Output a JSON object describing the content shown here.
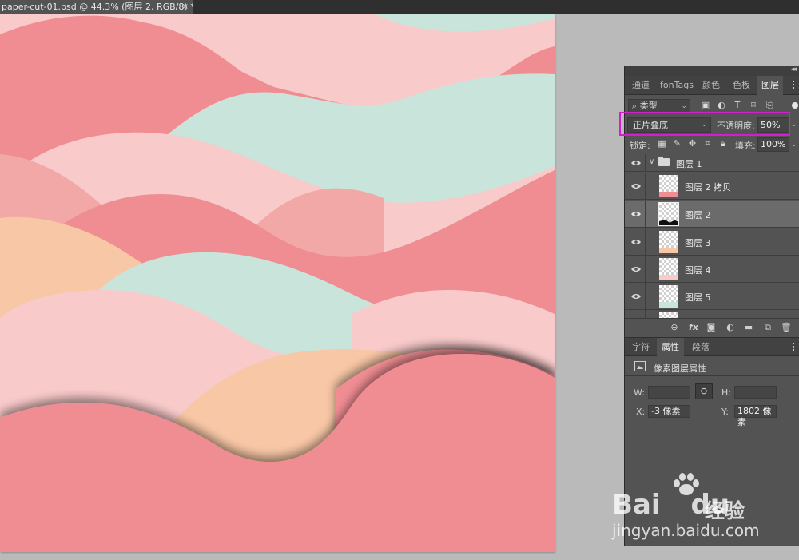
{
  "document": {
    "tab_title": "paper-cut-01.psd @ 44.3% (图层 2, RGB/8) *",
    "close_glyph": "×"
  },
  "colors": {
    "pink_light": "#f9caca",
    "pink_mid": "#f3a8a8",
    "pink_dark": "#f08d93",
    "mint": "#c9e4da",
    "peach": "#f8c7a6",
    "highlight": "#d61cd0"
  },
  "layers_panel": {
    "tabs": [
      "通道",
      "fonTags",
      "颜色",
      "色板",
      "图层"
    ],
    "active_tab": "图层",
    "filter": {
      "label": "类型",
      "icons": [
        "image-filter-icon",
        "adjustment-filter-icon",
        "type-filter-icon",
        "shape-filter-icon",
        "smart-object-filter-icon"
      ]
    },
    "blend_mode": "正片叠底",
    "opacity_label": "不透明度:",
    "opacity_value": "50%",
    "lock_label": "锁定:",
    "fill_label": "填充:",
    "fill_value": "100%",
    "group": {
      "name": "图层 1",
      "visible": true
    },
    "layers": [
      {
        "name": "图层 2 拷贝",
        "visible": true,
        "thumb_color": "#f08d93",
        "selected": false
      },
      {
        "name": "图层 2",
        "visible": true,
        "thumb_color": "#111111",
        "selected": true
      },
      {
        "name": "图层 3",
        "visible": true,
        "thumb_color": "#f8c7a6",
        "selected": false
      },
      {
        "name": "图层 4",
        "visible": true,
        "thumb_color": "#f9caca",
        "selected": false
      },
      {
        "name": "图层 5",
        "visible": true,
        "thumb_color": "#c9e4da",
        "selected": false
      }
    ],
    "footer_icons": [
      "link-icon",
      "fx-icon",
      "mask-icon",
      "adjustment-icon",
      "folder-icon",
      "new-layer-icon",
      "trash-icon"
    ]
  },
  "properties_panel": {
    "tabs": [
      "字符",
      "属性",
      "段落"
    ],
    "active_tab": "属性",
    "header": "像素图层属性",
    "w_label": "W:",
    "h_label": "H:",
    "x_label": "X:",
    "x_value": "-3 像素",
    "y_label": "Y:",
    "y_value": "1802 像素"
  },
  "watermark": {
    "brand": "Bai",
    "brand2": "du",
    "cn": "经验",
    "url": "jingyan.baidu.com"
  }
}
